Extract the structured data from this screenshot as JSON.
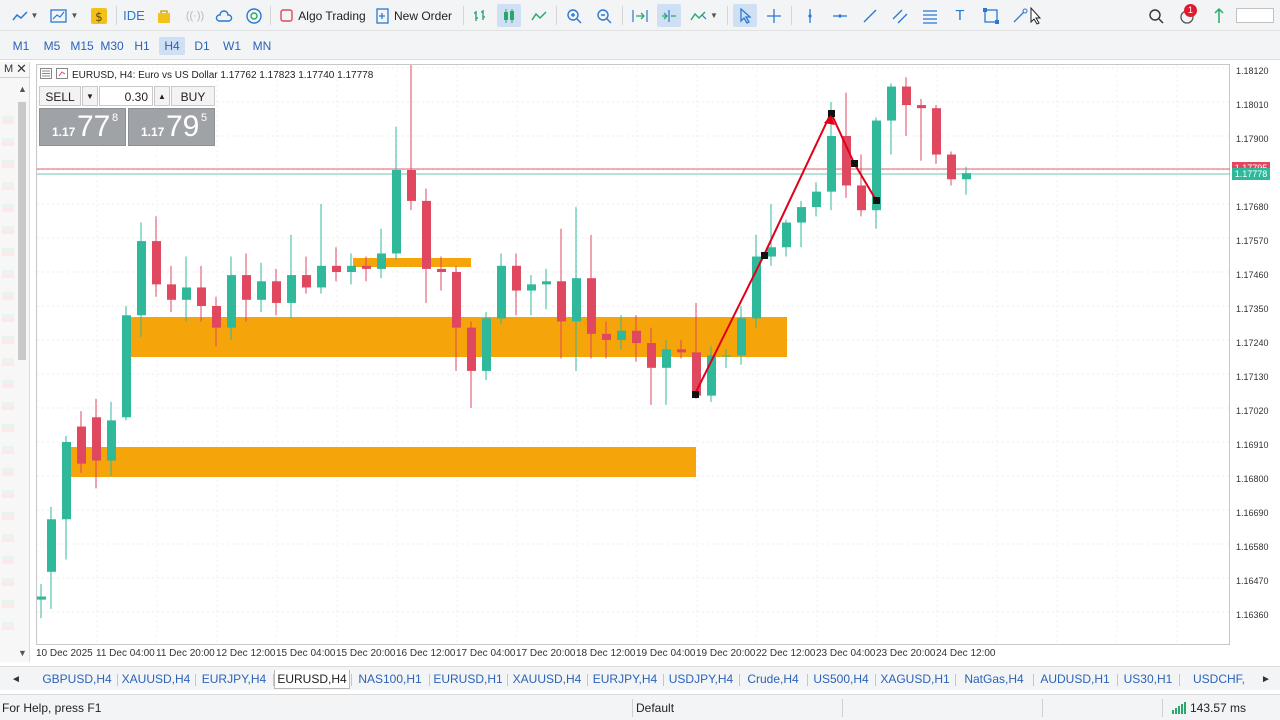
{
  "toolbar": {
    "ide_label": "IDE",
    "algo_trading_label": "Algo Trading",
    "new_order_label": "New Order",
    "notification_count": "1"
  },
  "timeframes": [
    "M1",
    "M5",
    "M15",
    "M30",
    "H1",
    "H4",
    "D1",
    "W1",
    "MN"
  ],
  "active_timeframe": "H4",
  "left_strip_label": "M",
  "chart": {
    "title": "EURUSD, H4:  Euro vs US Dollar  1.17762 1.17823 1.17740 1.17778",
    "trade_panel": {
      "sell_label": "SELL",
      "buy_label": "BUY",
      "volume": "0.30",
      "sell_small": "1.17",
      "sell_big": "77",
      "sell_sup": "8",
      "buy_small": "1.17",
      "buy_big": "79",
      "buy_sup": "5"
    },
    "price_labels": [
      "1.18120",
      "1.18010",
      "1.17900",
      "1.17680",
      "1.17570",
      "1.17460",
      "1.17350",
      "1.17240",
      "1.17130",
      "1.17020",
      "1.16910",
      "1.16800",
      "1.16690",
      "1.16580",
      "1.16470",
      "1.16360"
    ],
    "ask_tag": "1.17795",
    "bid_tag": "1.17778",
    "time_labels": [
      "10 Dec 2025",
      "11 Dec 04:00",
      "11 Dec 20:00",
      "12 Dec 12:00",
      "15 Dec 04:00",
      "15 Dec 20:00",
      "16 Dec 12:00",
      "17 Dec 04:00",
      "17 Dec 20:00",
      "18 Dec 12:00",
      "19 Dec 04:00",
      "19 Dec 20:00",
      "22 Dec 12:00",
      "23 Dec 04:00",
      "23 Dec 20:00",
      "24 Dec 12:00"
    ],
    "colors": {
      "bull": "#2fb89a",
      "bear": "#e0485f",
      "zone": "#f5a50a",
      "trendline": "#e0001a",
      "ask_line": "#e06070",
      "bid_line": "#6fc4ad"
    }
  },
  "tabs": [
    "GBPUSD,H4",
    "XAUUSD,H4",
    "EURJPY,H4",
    "EURUSD,H4",
    "NAS100,H1",
    "EURUSD,H1",
    "XAUUSD,H4",
    "EURJPY,H4",
    "USDJPY,H4",
    "Crude,H4",
    "US500,H4",
    "XAGUSD,H1",
    "NatGas,H4",
    "AUDUSD,H1",
    "US30,H1",
    "USDCHF,"
  ],
  "active_tab": "EURUSD,H4",
  "status": {
    "help_text": "For Help, press F1",
    "profile": "Default",
    "ping": "143.57 ms"
  }
}
